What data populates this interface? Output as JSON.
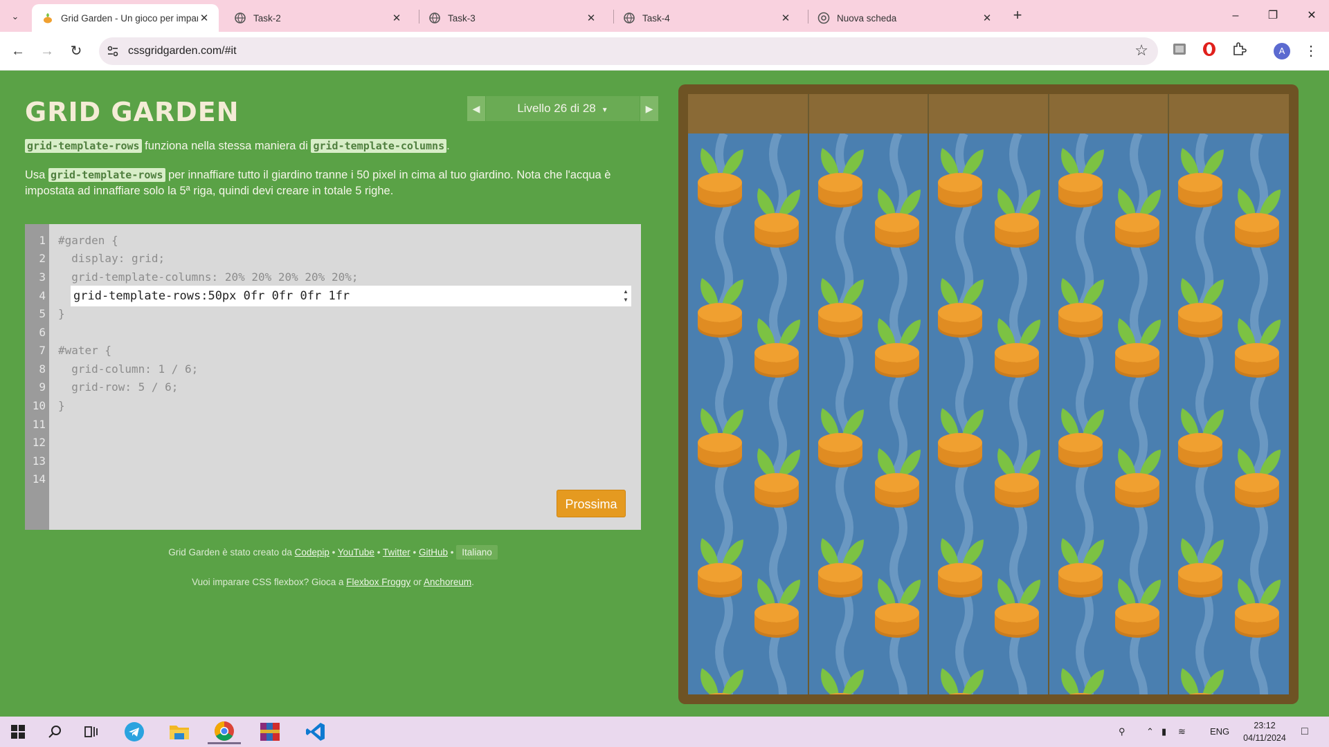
{
  "browser": {
    "tabs": [
      {
        "title": "Grid Garden - Un gioco per imparare",
        "active": true
      },
      {
        "title": "Task-2",
        "active": false
      },
      {
        "title": "Task-3",
        "active": false
      },
      {
        "title": "Task-4",
        "active": false
      },
      {
        "title": "Nuova scheda",
        "active": false
      }
    ],
    "url": "cssgridgarden.com/#it",
    "profile_initial": "A"
  },
  "game": {
    "logo": "GRID GARDEN",
    "level_label": "Livello 26 di 28",
    "instructions_1": {
      "code_a": "grid-template-rows",
      "text_a": " funziona nella stessa maniera di ",
      "code_b": "grid-template-columns",
      "text_b": "."
    },
    "instructions_2": {
      "text_a": "Usa ",
      "code_a": "grid-template-rows",
      "text_b": " per innaffiare tutto il giardino tranne i 50 pixel in cima al tuo giardino. Nota che l'acqua è impostata ad innaffiare solo la 5ª riga, quindi devi creare in totale 5 righe."
    },
    "line_numbers": [
      "1",
      "2",
      "3",
      "4",
      "5",
      "6",
      "7",
      "8",
      "9",
      "10",
      "11",
      "12",
      "13",
      "14"
    ],
    "code": {
      "l1": "#garden {",
      "l2": "  display: grid;",
      "l3": "  grid-template-columns: 20% 20% 20% 20% 20%;",
      "l5": "}",
      "l7": "#water {",
      "l8": "  grid-column: 1 / 6;",
      "l9": "  grid-row: 5 / 6;",
      "l10": "}"
    },
    "input_value": "grid-template-rows:50px 0fr 0fr 0fr 1fr",
    "next_button": "Prossima",
    "credits": {
      "prefix": "Grid Garden è stato creato da ",
      "codepip": "Codepip",
      "youtube": "YouTube",
      "twitter": "Twitter",
      "github": "GitHub",
      "language": "Italiano",
      "sep": " • "
    },
    "promo": {
      "prefix": "Vuoi imparare CSS flexbox? Gioca a ",
      "froggy": "Flexbox Froggy",
      "or": " or ",
      "anchoreum": "Anchoreum",
      "suffix": "."
    }
  },
  "taskbar": {
    "language": "ENG",
    "time": "23:12",
    "date": "04/11/2024"
  },
  "colors": {
    "page_bg": "#5aa246",
    "tab_strip": "#f9d2df",
    "button_orange": "#e59a20",
    "soil": "#8a6a36",
    "water": "#4a7fb0",
    "carrot": "#f0a030",
    "leaf": "#7cc243"
  }
}
